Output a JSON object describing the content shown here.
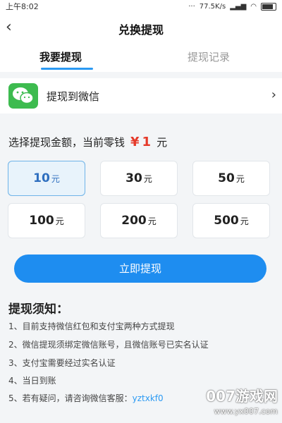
{
  "status_bar": {
    "time": "上午8:02",
    "dots": "···",
    "network_speed": "77.5K/s",
    "battery": "100"
  },
  "header": {
    "title": "兑换提现"
  },
  "tabs": [
    {
      "label": "我要提现",
      "active": true
    },
    {
      "label": "提现记录",
      "active": false
    }
  ],
  "method": {
    "label": "提现到微信",
    "icon": "wechat-icon"
  },
  "balance_prompt": {
    "text": "选择提现金额，当前零钱",
    "currency_symbol": "¥",
    "amount": "1",
    "unit": "元"
  },
  "amounts": [
    {
      "value": "10",
      "unit": "元",
      "selected": true
    },
    {
      "value": "30",
      "unit": "元",
      "selected": false
    },
    {
      "value": "50",
      "unit": "元",
      "selected": false
    },
    {
      "value": "100",
      "unit": "元",
      "selected": false
    },
    {
      "value": "200",
      "unit": "元",
      "selected": false
    },
    {
      "value": "500",
      "unit": "元",
      "selected": false
    }
  ],
  "submit": {
    "label": "立即提现"
  },
  "notes": {
    "title": "提现须知：",
    "items": [
      "1、目前支持微信红包和支付宝两种方式提现",
      "2、微信提现须绑定微信账号，且微信账号已实名认证",
      "3、支付宝需要经过实名认证",
      "4、当日到账"
    ],
    "contact_prefix": "5、若有疑问，请咨询微信客服：",
    "contact_id": "yztxkf0"
  },
  "watermark": {
    "brand": "007游戏网",
    "url": "www.yx007.com"
  },
  "colors": {
    "accent": "#1e8df0",
    "tab_indicator": "#2b9af3",
    "price": "#e53a2a",
    "wechat_green": "#3dbb4f"
  }
}
